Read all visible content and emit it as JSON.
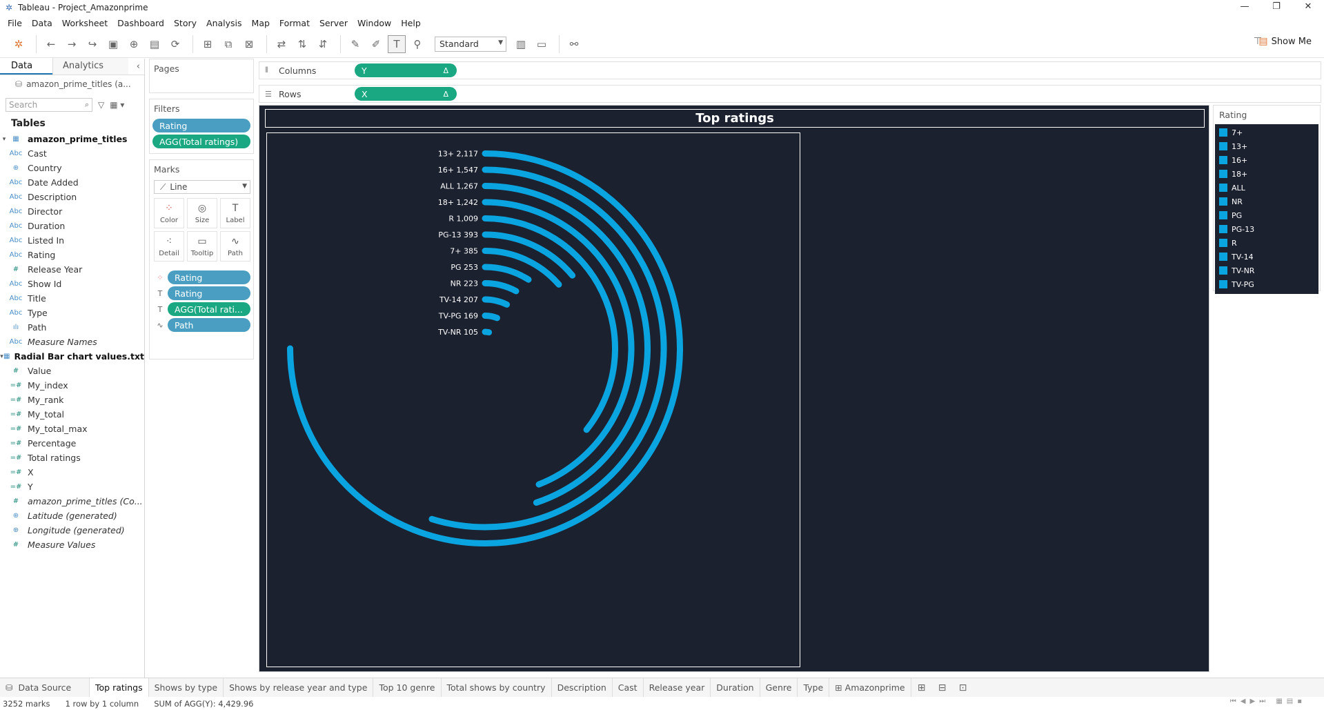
{
  "window": {
    "title": "Tableau - Project_Amazonprime",
    "controls": [
      "—",
      "❐",
      "✕"
    ]
  },
  "menu": [
    "File",
    "Data",
    "Worksheet",
    "Dashboard",
    "Story",
    "Analysis",
    "Map",
    "Format",
    "Server",
    "Window",
    "Help"
  ],
  "toolbar": {
    "fit_select": "Standard",
    "show_me": "Show Me"
  },
  "data_pane": {
    "tab_data": "Data",
    "tab_analytics": "Analytics",
    "datasource": "amazon_prime_titles (a...",
    "search_placeholder": "Search",
    "tables_label": "Tables",
    "table1": {
      "name": "amazon_prime_titles",
      "fields": [
        {
          "type": "Abc",
          "name": "Cast"
        },
        {
          "type": "⊕",
          "name": "Country"
        },
        {
          "type": "Abc",
          "name": "Date Added"
        },
        {
          "type": "Abc",
          "name": "Description"
        },
        {
          "type": "Abc",
          "name": "Director"
        },
        {
          "type": "Abc",
          "name": "Duration"
        },
        {
          "type": "Abc",
          "name": "Listed In"
        },
        {
          "type": "Abc",
          "name": "Rating"
        },
        {
          "type": "#",
          "name": "Release Year"
        },
        {
          "type": "Abc",
          "name": "Show Id"
        },
        {
          "type": "Abc",
          "name": "Title"
        },
        {
          "type": "Abc",
          "name": "Type"
        }
      ]
    },
    "extra_fields": [
      {
        "type": "ılı",
        "name": "Path"
      },
      {
        "type": "Abc",
        "name": "Measure Names"
      }
    ],
    "table2": {
      "name": "Radial Bar chart values.txt",
      "fields": [
        {
          "type": "#",
          "name": "Value"
        }
      ]
    },
    "calc_fields": [
      {
        "type": "=#",
        "name": "My_index"
      },
      {
        "type": "=#",
        "name": "My_rank"
      },
      {
        "type": "=#",
        "name": "My_total"
      },
      {
        "type": "=#",
        "name": "My_total_max"
      },
      {
        "type": "=#",
        "name": "Percentage"
      },
      {
        "type": "=#",
        "name": "Total ratings"
      },
      {
        "type": "=#",
        "name": "X"
      },
      {
        "type": "=#",
        "name": "Y"
      },
      {
        "type": "#",
        "name": "amazon_prime_titles (Co..."
      },
      {
        "type": "⊕",
        "name": "Latitude (generated)"
      },
      {
        "type": "⊕",
        "name": "Longitude (generated)"
      },
      {
        "type": "#",
        "name": "Measure Values"
      }
    ]
  },
  "shelves": {
    "pages_label": "Pages",
    "filters_label": "Filters",
    "filters": [
      "Rating",
      "AGG(Total ratings)"
    ],
    "marks_label": "Marks",
    "mark_type": "Line",
    "mark_buttons": [
      "Color",
      "Size",
      "Label",
      "Detail",
      "Tooltip",
      "Path"
    ],
    "mark_pills": [
      {
        "icon": "color",
        "label": "Rating",
        "kind": "dim"
      },
      {
        "icon": "label",
        "label": "Rating",
        "kind": "dim"
      },
      {
        "icon": "label",
        "label": "AGG(Total rati...",
        "kind": "mea"
      },
      {
        "icon": "path",
        "label": "Path",
        "kind": "dim"
      }
    ],
    "columns_label": "Columns",
    "columns_pill": "Y",
    "rows_label": "Rows",
    "rows_pill": "X",
    "delta": "Δ"
  },
  "viz": {
    "title": "Top ratings"
  },
  "chart_data": {
    "type": "bar",
    "subtype": "radial",
    "title": "Top ratings",
    "categories": [
      "13+",
      "16+",
      "ALL",
      "18+",
      "R",
      "PG-13",
      "7+",
      "PG",
      "NR",
      "TV-14",
      "TV-PG",
      "TV-NR"
    ],
    "values": [
      2117,
      1547,
      1267,
      1242,
      1009,
      393,
      385,
      253,
      223,
      207,
      169,
      105
    ],
    "labels": [
      "13+ 2,117",
      "16+ 1,547",
      "ALL 1,267",
      "18+ 1,242",
      "R 1,009",
      "PG-13 393",
      "7+ 385",
      "PG 253",
      "NR 223",
      "TV-14 207",
      "TV-PG 169",
      "TV-NR 105"
    ],
    "color": "#0aa5e0",
    "background": "#1c2130"
  },
  "legend": {
    "title": "Rating",
    "items": [
      "7+",
      "13+",
      "16+",
      "18+",
      "ALL",
      "NR",
      "PG",
      "PG-13",
      "R",
      "TV-14",
      "TV-NR",
      "TV-PG"
    ]
  },
  "sheet_tabs": {
    "data_source": "Data Source",
    "tabs": [
      "Top ratings",
      "Shows by type",
      "Shows by release year and type",
      "Top 10 genre",
      "Total shows by country",
      "Description",
      "Cast",
      "Release year",
      "Duration",
      "Genre",
      "Type",
      "Amazonprime"
    ],
    "active": "Top ratings"
  },
  "status": {
    "marks": "3252 marks",
    "rows": "1 row by 1 column",
    "sum": "SUM of AGG(Y): 4,429.96"
  }
}
